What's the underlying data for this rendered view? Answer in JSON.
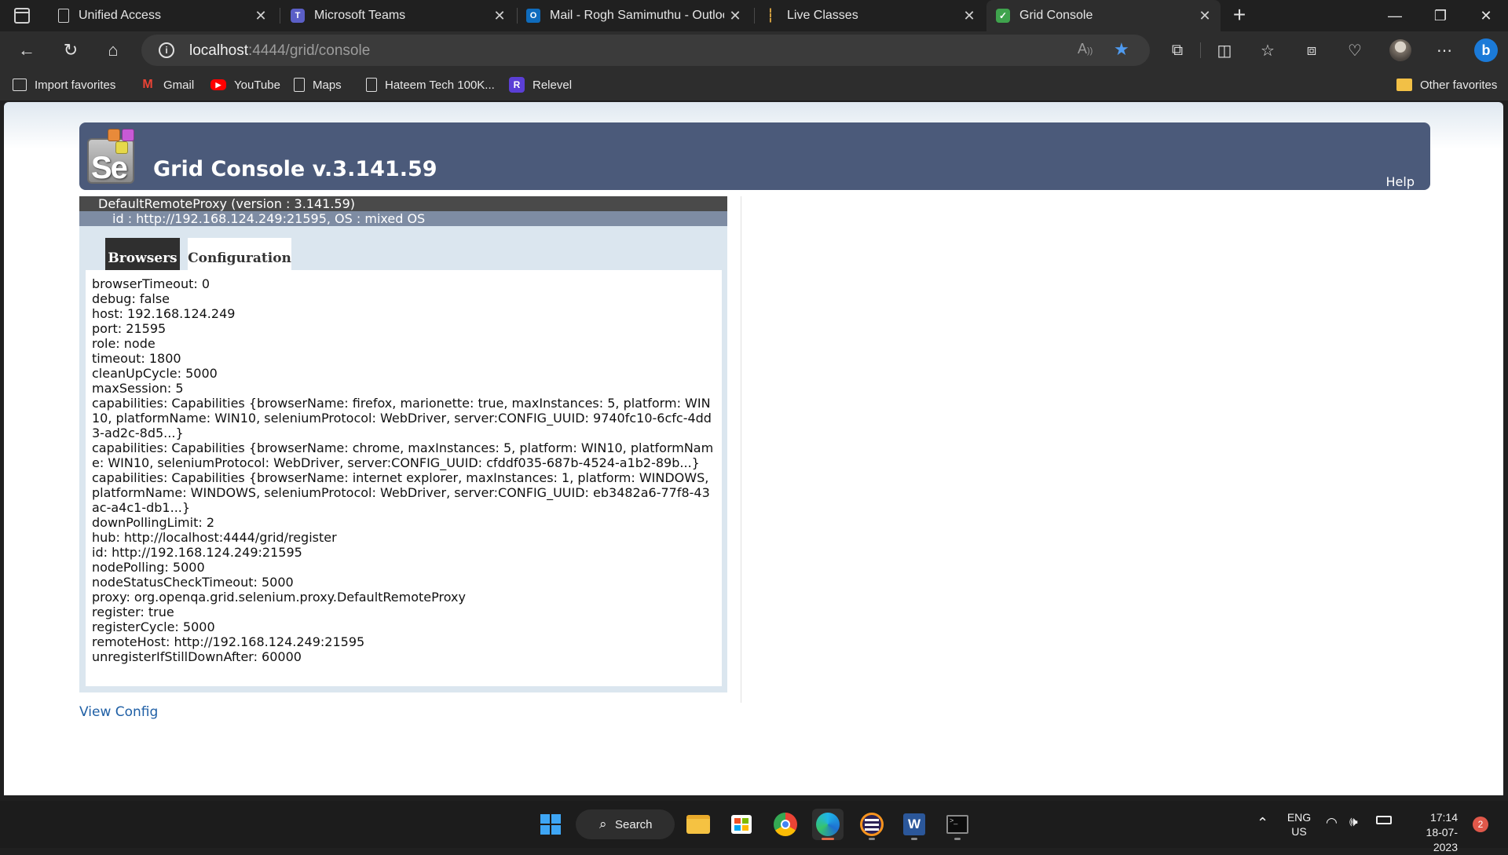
{
  "browser": {
    "tabs": [
      {
        "title": "Unified Access",
        "icon": "page-icon",
        "active": false
      },
      {
        "title": "Microsoft Teams",
        "icon": "teams-icon",
        "active": false
      },
      {
        "title": "Mail - Rogh Samimuthu - Outlook",
        "icon": "outlook-icon",
        "active": false
      },
      {
        "title": "Live Classes",
        "icon": "chart-icon",
        "active": false
      },
      {
        "title": "Grid Console",
        "icon": "shield-check-icon",
        "active": true
      }
    ],
    "new_tab_label": "+",
    "url_host": "localhost",
    "url_path": ":4444/grid/console",
    "favorites": [
      {
        "label": "Import favorites",
        "icon": "import-icon"
      },
      {
        "label": "Gmail",
        "icon": "gmail-icon"
      },
      {
        "label": "YouTube",
        "icon": "youtube-icon"
      },
      {
        "label": "Maps",
        "icon": "page-icon"
      },
      {
        "label": "Hateem Tech 100K...",
        "icon": "page-icon"
      },
      {
        "label": "Relevel",
        "icon": "relevel-icon"
      }
    ],
    "other_favorites": "Other favorites"
  },
  "page": {
    "title": "Grid Console v.3.141.59",
    "help": "Help",
    "logo_text": "Se",
    "proxy_line1": "DefaultRemoteProxy (version : 3.141.59)",
    "proxy_line2": "id : http://192.168.124.249:21595, OS : mixed OS",
    "tab_browsers": "Browsers",
    "tab_configuration": "Configuration",
    "config_lines": [
      "browserTimeout: 0",
      "debug: false",
      "host: 192.168.124.249",
      "port: 21595",
      "role: node",
      "timeout: 1800",
      "cleanUpCycle: 5000",
      "maxSession: 5",
      "capabilities: Capabilities {browserName: firefox, marionette: true, maxInstances: 5, platform: WIN10, platformName: WIN10, seleniumProtocol: WebDriver, server:CONFIG_UUID: 9740fc10-6cfc-4dd3-ad2c-8d5...}",
      "capabilities: Capabilities {browserName: chrome, maxInstances: 5, platform: WIN10, platformName: WIN10, seleniumProtocol: WebDriver, server:CONFIG_UUID: cfddf035-687b-4524-a1b2-89b...}",
      "capabilities: Capabilities {browserName: internet explorer, maxInstances: 1, platform: WINDOWS, platformName: WINDOWS, seleniumProtocol: WebDriver, server:CONFIG_UUID: eb3482a6-77f8-43ac-a4c1-db1...}",
      "downPollingLimit: 2",
      "hub: http://localhost:4444/grid/register",
      "id: http://192.168.124.249:21595",
      "nodePolling: 5000",
      "nodeStatusCheckTimeout: 5000",
      "proxy: org.openqa.grid.selenium.proxy.DefaultRemoteProxy",
      "register: true",
      "registerCycle: 5000",
      "remoteHost: http://192.168.124.249:21595",
      "unregisterIfStillDownAfter: 60000"
    ],
    "view_config": "View Config"
  },
  "taskbar": {
    "search_label": "Search",
    "lang_top": "ENG",
    "lang_bottom": "US",
    "time": "17:14",
    "date": "18-07-2023",
    "notification_count": "2",
    "apps": [
      "start-icon",
      "file-explorer-icon",
      "store-icon",
      "chrome-icon",
      "edge-icon",
      "eclipse-icon",
      "word-icon",
      "terminal-icon"
    ]
  },
  "colors": {
    "header_bg": "#4b5a7a",
    "proxy_head_dark": "#4a4a4a",
    "proxy_head_light": "#7e8ca3",
    "panel_bg": "#dbe6ef",
    "link": "#1f5fa5"
  }
}
